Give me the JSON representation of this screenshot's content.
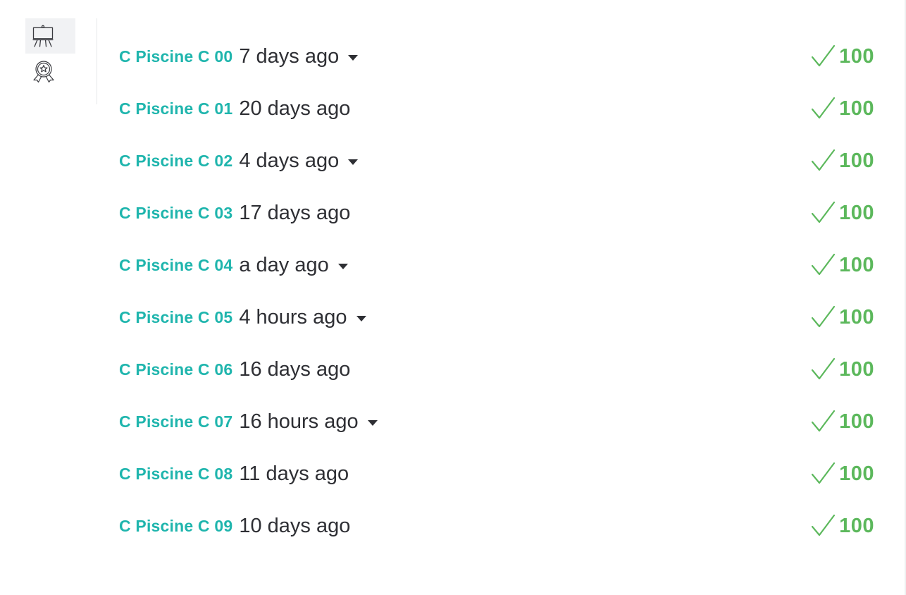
{
  "sidebar": {
    "items": [
      {
        "icon": "easel-icon",
        "active": true
      },
      {
        "icon": "achievement-badge-icon",
        "active": false
      }
    ]
  },
  "projects": [
    {
      "name": "C Piscine C 00",
      "time": "7 days ago",
      "has_dropdown": true,
      "status_icon": "checkmark-icon",
      "score": "100"
    },
    {
      "name": "C Piscine C 01",
      "time": "20 days ago",
      "has_dropdown": false,
      "status_icon": "checkmark-icon",
      "score": "100"
    },
    {
      "name": "C Piscine C 02",
      "time": "4 days ago",
      "has_dropdown": true,
      "status_icon": "checkmark-icon",
      "score": "100"
    },
    {
      "name": "C Piscine C 03",
      "time": "17 days ago",
      "has_dropdown": false,
      "status_icon": "checkmark-icon",
      "score": "100"
    },
    {
      "name": "C Piscine C 04",
      "time": "a day ago",
      "has_dropdown": true,
      "status_icon": "checkmark-icon",
      "score": "100"
    },
    {
      "name": "C Piscine C 05",
      "time": "4 hours ago",
      "has_dropdown": true,
      "status_icon": "checkmark-icon",
      "score": "100"
    },
    {
      "name": "C Piscine C 06",
      "time": "16 days ago",
      "has_dropdown": false,
      "status_icon": "checkmark-icon",
      "score": "100"
    },
    {
      "name": "C Piscine C 07",
      "time": "16 hours ago",
      "has_dropdown": true,
      "status_icon": "checkmark-icon",
      "score": "100"
    },
    {
      "name": "C Piscine C 08",
      "time": "11 days ago",
      "has_dropdown": false,
      "status_icon": "checkmark-icon",
      "score": "100"
    },
    {
      "name": "C Piscine C 09",
      "time": "10 days ago",
      "has_dropdown": false,
      "status_icon": "checkmark-icon",
      "score": "100"
    }
  ],
  "colors": {
    "project_link": "#1fb5ad",
    "success": "#5cb85c",
    "text": "#2e2f34",
    "active_tab_bg": "#f1f2f4"
  }
}
